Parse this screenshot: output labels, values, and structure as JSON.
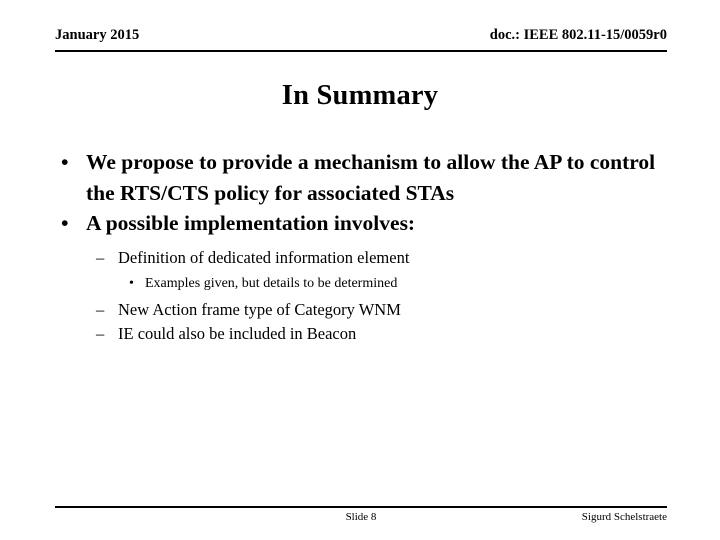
{
  "header": {
    "date": "January 2015",
    "doc": "doc.: IEEE 802.11-15/0059r0"
  },
  "title": "In Summary",
  "bullets": {
    "b1": "We propose to provide a mechanism to allow the AP to control the RTS/CTS policy for associated STAs",
    "b2": "A possible implementation involves:",
    "b2_sub1": "Definition of dedicated information element",
    "b2_sub1_sub1": "Examples given, but details to be determined",
    "b2_sub2": "New Action frame type of Category WNM",
    "b2_sub3": "IE could also be included in Beacon"
  },
  "markers": {
    "level1": "•",
    "level2": "–",
    "level3": "•"
  },
  "footer": {
    "slide": "Slide 8",
    "author": "Sigurd Schelstraete"
  }
}
